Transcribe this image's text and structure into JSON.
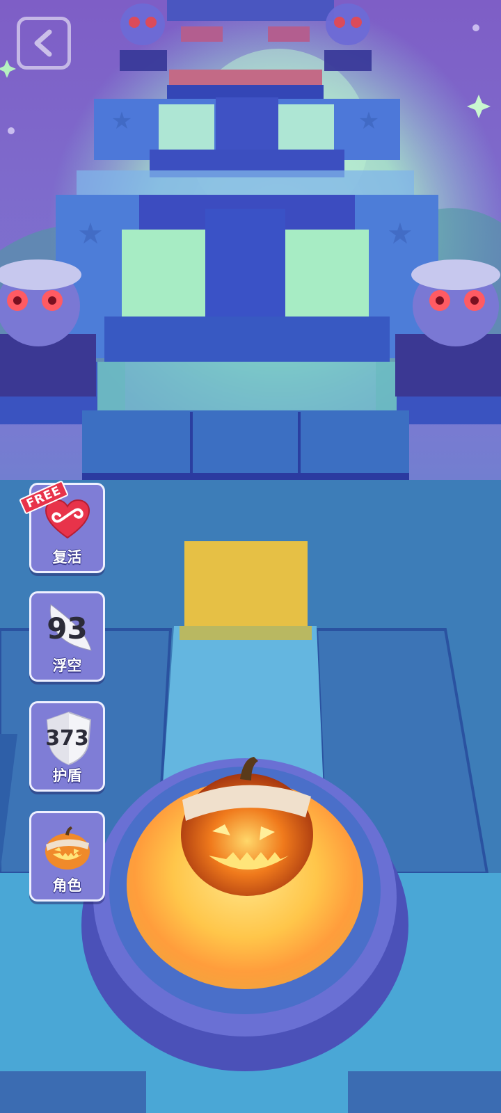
{
  "scene": {
    "colors": {
      "sky_top": "#7a5fc4",
      "sky_mid": "#6a8fd1",
      "ground": "#3a7fb5",
      "tile_blue": "#3c63c8",
      "tile_dark": "#2f3ea6",
      "tile_yellow": "#e6c045",
      "glow_green": "#9fe3c3"
    }
  },
  "back_button": {
    "icon": "chevron-left-icon"
  },
  "powerups": [
    {
      "id": "revive",
      "label": "复活",
      "badge": "FREE",
      "icon": "infinity-heart-icon",
      "accent": "#e8334a"
    },
    {
      "id": "float",
      "label": "浮空",
      "count": "93",
      "icon": "feather-icon"
    },
    {
      "id": "shield",
      "label": "护盾",
      "count": "373",
      "icon": "shield-icon"
    },
    {
      "id": "character",
      "label": "角色",
      "icon": "pumpkin-icon"
    }
  ]
}
